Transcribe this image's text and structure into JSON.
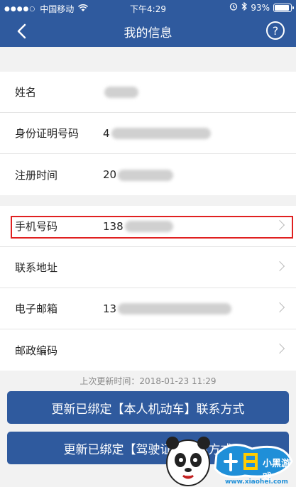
{
  "statusbar": {
    "carrier": "中国移动",
    "time": "下午4:29",
    "battery": "93%"
  },
  "nav": {
    "title": "我的信息",
    "help": "?"
  },
  "section1": [
    {
      "label": "姓名",
      "value": ""
    },
    {
      "label": "身份证明号码",
      "value": "4"
    },
    {
      "label": "注册时间",
      "value": "20"
    }
  ],
  "section2": [
    {
      "label": "手机号码",
      "value": "138"
    },
    {
      "label": "联系地址",
      "value": ""
    },
    {
      "label": "电子邮箱",
      "value": "13"
    },
    {
      "label": "邮政编码",
      "value": ""
    }
  ],
  "update_time": "上次更新时间：2018-01-23 11:29",
  "buttons": {
    "update_vehicle": "更新已绑定【本人机动车】联系方式",
    "update_license": "更新已绑定【驾驶证】联系方式"
  },
  "watermark": {
    "name": "小黑游戏",
    "url": "www.xiaohei.com"
  },
  "colors": {
    "primary": "#2f5a9e",
    "highlight": "#e02020"
  }
}
